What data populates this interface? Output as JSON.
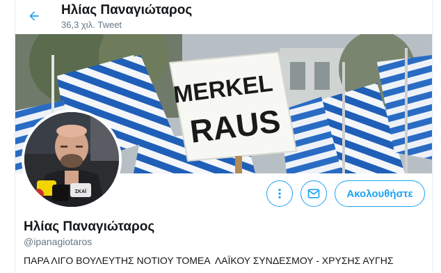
{
  "header": {
    "name": "Ηλίας Παναγιώταρος",
    "tweet_count": "36,3 χιλ. Tweet"
  },
  "banner": {
    "sign_line1": "MERKEL",
    "sign_line2": "RAUS"
  },
  "avatar": {
    "mic_label": "ΣΚΑΪ"
  },
  "actions": {
    "more_icon": "more-vertical-icon",
    "message_icon": "envelope-icon",
    "follow_label": "Ακολουθήστε"
  },
  "profile": {
    "name": "Ηλίας Παναγιώταρος",
    "handle": "@ipanagiotaros",
    "bio": "ΠΑΡΑ ΛΙΓΟ ΒΟΥΛΕΥΤΗΣ ΝΟΤΙΟΥ ΤΟΜΕΑ  ΛΑΪΚΟΥ ΣΥΝΔΕΣΜΟΥ - ΧΡΥΣΗΣ ΑΥΓΗΣ"
  },
  "colors": {
    "accent": "#1da1f2",
    "text": "#14171a",
    "secondary": "#657786",
    "flag_blue": "#1f5fb8"
  }
}
